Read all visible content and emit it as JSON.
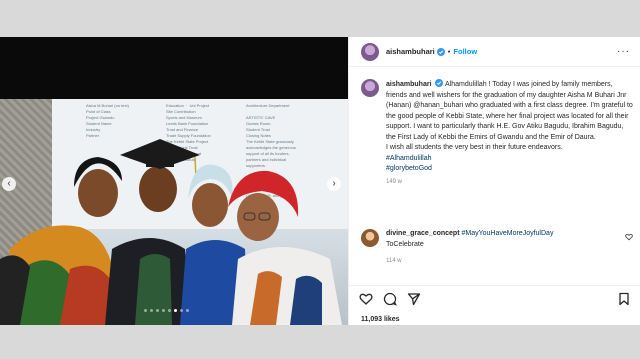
{
  "post": {
    "username": "aishambuhari",
    "follow_label": "Follow",
    "header_sep": "•",
    "caption_lines": [
      "Alhamdulillah ! Today I was joined by family",
      "members, friends and well wishers for the graduation of my",
      "daughter Aisha M Buhari Jnr (Hanan) @hanan_buhari who",
      "graduated with a first class degree. I’m grateful to the good",
      "people of Kebbi State, where her final project was located for all",
      "their support. I want to particularly thank H.E. Gov Atiku Bagudu,",
      "Ibrahim Bagudu, the First Lady of Kebbi the Emirs of Gwandu and",
      "the Emir of Daura.",
      "I wish all students the very best in their future endeavors."
    ],
    "hashtags": [
      "#Alhamdulillah",
      "#glorybetoGod"
    ],
    "caption_time": "149 w",
    "likes": "11,093 likes"
  },
  "comment": {
    "username": "divine_grace_concept",
    "tag": "#MayYouHaveMoreJoyfulDay",
    "text": "ToCelebrate",
    "time": "114 w"
  },
  "photo": {
    "board_lines_a": "Aisha M Buhari (no text)\nPoint of Class\nProject Gwandu\nStudent Name\nIndustry\nPartner",
    "board_lines_b": "Education  ·  Uni Project\nSite Contribution\nSports and Museum\nLeeds Bank Foundation\nTrust and Finance\nTrade Supply Foundation\nThe Kebbi State Project\nPartner Link Trust\nFoundation Support\nGwandu Institute",
    "board_lines_c": "Architecture Department\n\nARTISTS' CAVE\nGuests Room\nStudent Trust\nClosing Notes",
    "board_lines_d": "The Kebbi State graciously\nacknowledges the generous\nsupport of all its funders,\npartners and individual\nsupporters.\n\nPUBLIC PARTNERS\n\nThis is the Graduation\nClass of 2019, and partners\nwho helped.",
    "slide_count": 8,
    "active_slide": 5
  }
}
